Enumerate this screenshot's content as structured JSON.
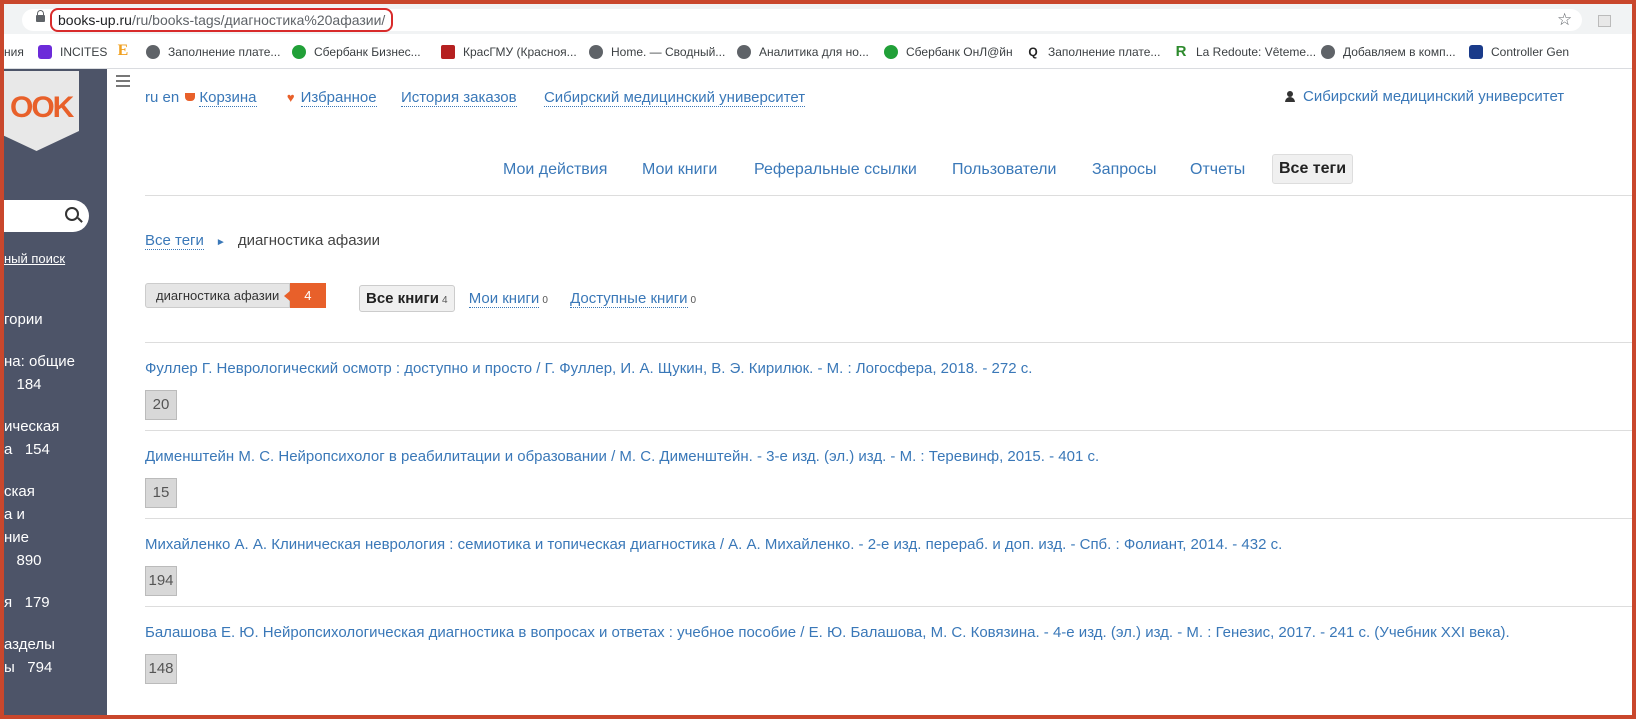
{
  "browser": {
    "url_host": "books-up.ru",
    "url_path": "/ru/books-tags/диагностика%20афазии/"
  },
  "bookmarks": [
    {
      "label": "ния",
      "icon": "none"
    },
    {
      "label": "INCITES",
      "icon": "incites-icon"
    },
    {
      "label": "",
      "icon": "e-icon"
    },
    {
      "label": "Заполнение плате...",
      "icon": "globe-icon"
    },
    {
      "label": "Сбербанк Бизнес...",
      "icon": "sberbank-icon"
    },
    {
      "label": "КрасГМУ (Красноя...",
      "icon": "krasgmu-icon"
    },
    {
      "label": "Home. — Сводный...",
      "icon": "globe-icon"
    },
    {
      "label": "Аналитика для но...",
      "icon": "globe-icon"
    },
    {
      "label": "Сбербанк ОнЛ@йн",
      "icon": "sberbank-icon"
    },
    {
      "label": "Заполнение плате...",
      "icon": "q-icon"
    },
    {
      "label": "La Redoute: Vêteme...",
      "icon": "redoute-icon"
    },
    {
      "label": "Добавляем в комп...",
      "icon": "globe-icon"
    },
    {
      "label": "Controller Gen",
      "icon": "nix-icon"
    }
  ],
  "sidebar": {
    "advanced_search": "ный поиск",
    "items": [
      "гории",
      "на: общие\n   184",
      "ическая\nа   154",
      "ская\nа и\nние\n   890",
      "я   179",
      "азделы\nы   794"
    ]
  },
  "header": {
    "lang_ru": "ru",
    "lang_en": "en",
    "cart": "Корзина",
    "favorites": "Избранное",
    "orders": "История заказов",
    "university": "Сибирский медицинский университет",
    "user_name": "Сибирский медицинский университет"
  },
  "nav": [
    {
      "label": "Мои действия",
      "active": false
    },
    {
      "label": "Мои книги",
      "active": false
    },
    {
      "label": "Реферальные ссылки",
      "active": false
    },
    {
      "label": "Пользователи",
      "active": false
    },
    {
      "label": "Запросы",
      "active": false
    },
    {
      "label": "Отчеты",
      "active": false
    },
    {
      "label": "Все теги",
      "active": true
    }
  ],
  "breadcrumb": {
    "root": "Все теги",
    "current": "диагностика афазии"
  },
  "tag": {
    "name": "диагностика афазии",
    "count": "4"
  },
  "filters": {
    "all_label": "Все книги",
    "all_count": "4",
    "mine_label": "Мои книги",
    "mine_count": "0",
    "available_label": "Доступные книги",
    "available_count": "0"
  },
  "books": [
    {
      "title": "Фуллер Г. Неврологический осмотр : доступно и просто / Г. Фуллер, И. А. Щукин, В. Э. Кирилюк. - М. : Логосфера, 2018. - 272 с.",
      "count": "20"
    },
    {
      "title": "Дименштейн М. С. Нейропсихолог в реабилитации и образовании / М. С. Дименштейн. - 3-е изд. (эл.) изд. - М. : Теревинф, 2015. - 401 с.",
      "count": "15"
    },
    {
      "title": "Михайленко А. А. Клиническая неврология : семиотика и топическая диагностика / А. А. Михайленко. - 2-е изд. перераб. и доп. изд. - Спб. : Фолиант, 2014. - 432 с.",
      "count": "194"
    },
    {
      "title": "Балашова Е. Ю. Нейропсихологическая диагностика в вопросах и ответах : учебное пособие / Е. Ю. Балашова, М. С. Ковязина. - 4-е изд. (эл.) изд. - М. : Генезис, 2017. - 241 с. (Учебник XXI века).",
      "count": "148"
    }
  ],
  "colors": {
    "link": "#3a78b8",
    "accent": "#e8602a",
    "sidebar": "#4d5468",
    "url_highlight": "#d82b2b"
  }
}
